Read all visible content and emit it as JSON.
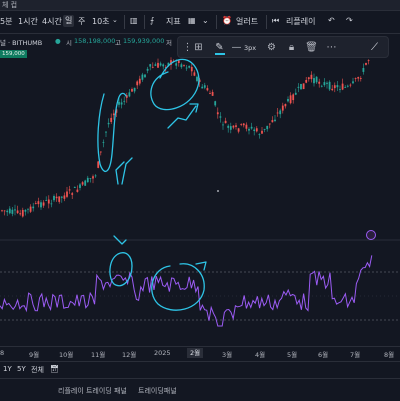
{
  "window": {
    "title": "체 컵"
  },
  "toolbar": {
    "interval_5m": "5분",
    "interval_1h": "1시간",
    "interval_4h": "4시간",
    "interval_1d": "일",
    "interval_1w": "주",
    "interval_10s": "10초",
    "indicators": "지표",
    "alert": "얼러트",
    "replay": "리플레이"
  },
  "symbol": {
    "name": "널 · BITHUMB",
    "open_label": "시",
    "open_value": "158,198,000",
    "high_label": "고",
    "high_value": "159,939,000",
    "low_label": "저",
    "price_badge": "159,000"
  },
  "drawing_toolbar": {
    "stroke_width": "3px"
  },
  "xaxis": {
    "labels": [
      "8",
      "9월",
      "10월",
      "11월",
      "12월",
      "2025",
      "2월",
      "3월",
      "4월",
      "5월",
      "6월",
      "7월",
      "8월"
    ]
  },
  "range": {
    "r1y": "1Y",
    "r5y": "5Y",
    "all": "전체"
  },
  "panels": {
    "replay_panel": "리플레이 트레이딩 패널",
    "trading_panel": "트레이딩패널"
  },
  "colors": {
    "up": "#26a69a",
    "down": "#ef5350",
    "rsi": "#9c5cf5",
    "annotation": "#2ec4e6"
  }
}
